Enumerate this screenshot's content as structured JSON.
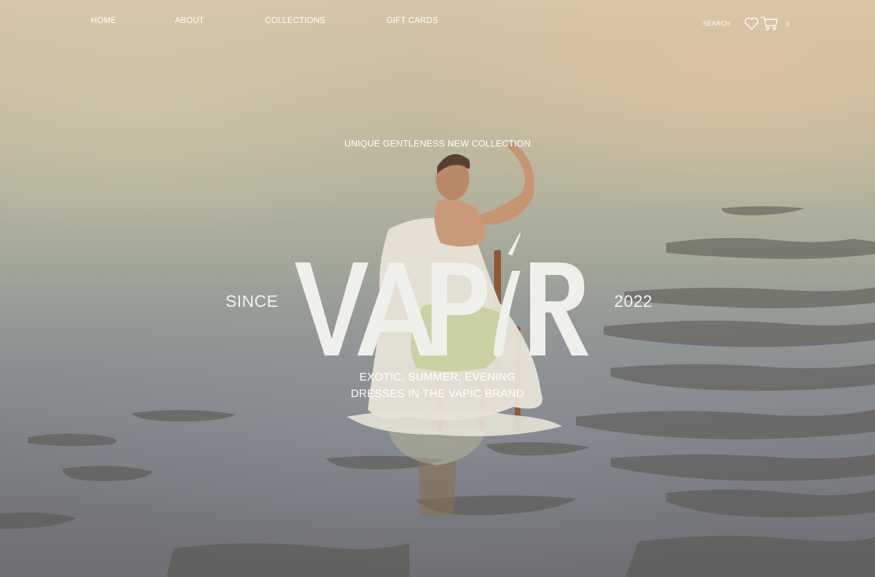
{
  "nav": {
    "items": [
      {
        "label": "HOME"
      },
      {
        "label": "ABOUT"
      },
      {
        "label": "COLLECTIONS"
      },
      {
        "label": "GIFT CARDS"
      }
    ],
    "search_label": "SEARCH",
    "wishlist_icon": "heart-icon",
    "cart_icon": "cart-icon",
    "cart_count": "0"
  },
  "hero": {
    "kicker": "UNIQUE GENTLENESS NEW COLLECTION",
    "brand": "VAPIR",
    "since_label": "SINCE",
    "year": "2022",
    "tagline_line1": "EXOTIC, SUMMER, EVENING",
    "tagline_line2": "DRESSES IN THE VAPIC BRAND"
  },
  "colors": {
    "text": "#ffffff",
    "brand_letters": "#efefec"
  }
}
